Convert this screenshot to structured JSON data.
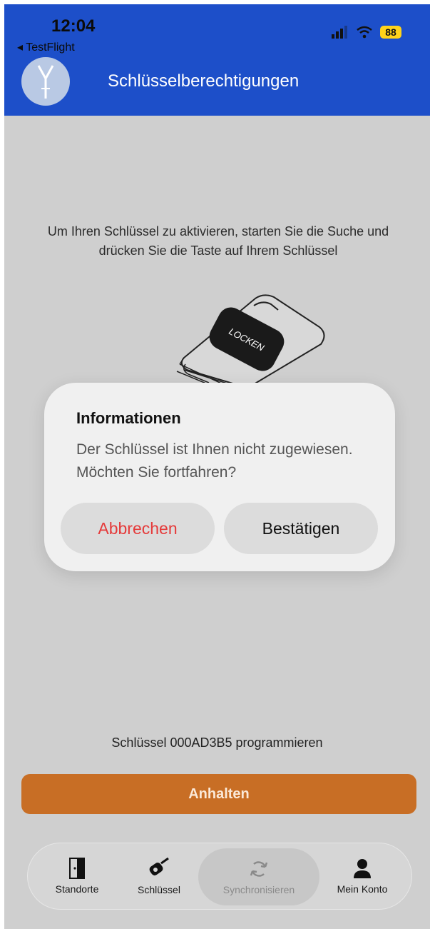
{
  "status_bar": {
    "time": "12:04",
    "back_app": "◂ TestFlight",
    "battery": "88"
  },
  "header": {
    "title": "Schlüsselberechtigungen"
  },
  "main": {
    "instructions": "Um Ihren Schlüssel zu aktivieren, starten Sie die Suche und drücken Sie die Taste auf Ihrem Schlüssel",
    "keyfob_brand": "LOCKEN",
    "program_status": "Schlüssel 000AD3B5 programmieren",
    "stop_button": "Anhalten"
  },
  "dialog": {
    "title": "Informationen",
    "message": "Der Schlüssel ist Ihnen nicht zugewiesen. Möchten Sie fortfahren?",
    "cancel": "Abbrechen",
    "confirm": "Bestätigen"
  },
  "tabbar": {
    "items": [
      {
        "label": "Standorte",
        "icon": "door-icon"
      },
      {
        "label": "Schlüssel",
        "icon": "key-fob-icon"
      },
      {
        "label": "Synchronisieren",
        "icon": "sync-icon"
      },
      {
        "label": "Mein Konto",
        "icon": "person-icon"
      }
    ]
  },
  "colors": {
    "header": "#1d4fc9",
    "accent_stop": "#c86e25",
    "cancel_text": "#e53a3a",
    "battery": "#ffd31a"
  }
}
